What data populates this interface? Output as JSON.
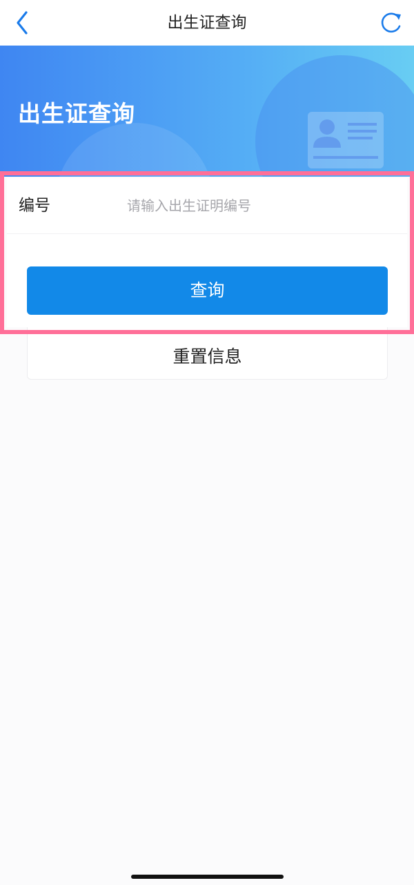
{
  "navbar": {
    "title": "出生证查询",
    "back_icon": "chevron-left-icon",
    "refresh_icon": "refresh-icon",
    "accent_color": "#1a7bea"
  },
  "banner": {
    "title": "出生证查询",
    "icon": "id-card-icon",
    "gradient_colors": [
      "#3f86f2",
      "#68cdf3"
    ]
  },
  "form": {
    "number_label": "编号",
    "number_placeholder": "请输入出生证明编号",
    "number_value": ""
  },
  "actions": {
    "query_label": "查询",
    "reset_label": "重置信息",
    "query_color": "#1289e8"
  },
  "highlight": {
    "color": "#ff6f98"
  }
}
